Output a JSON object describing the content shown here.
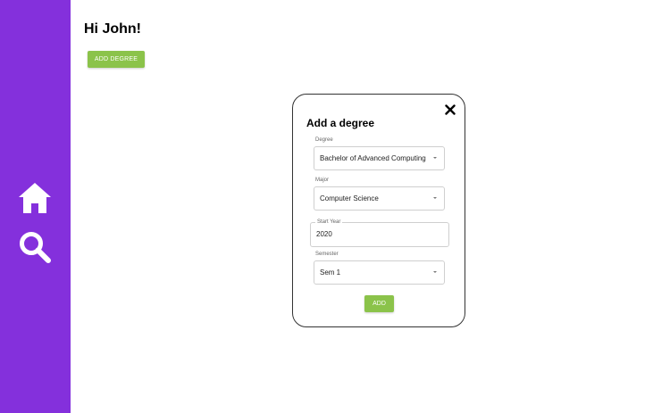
{
  "sidebar": {
    "items": [
      {
        "icon": "home-icon",
        "color": "#ffffff"
      },
      {
        "icon": "search-icon",
        "color": "#ffffff"
      }
    ],
    "background": "#8430dc"
  },
  "main": {
    "greeting": "Hi John!",
    "add_degree_label": "ADD DEGREE"
  },
  "modal": {
    "title": "Add a degree",
    "close_icon": "close-icon",
    "degree": {
      "label": "Degree",
      "value": "Bachelor of Advanced Computing"
    },
    "major": {
      "label": "Major",
      "value": "Computer Science"
    },
    "start_year": {
      "label": "Start Year",
      "value": "2020"
    },
    "semester": {
      "label": "Semester",
      "value": "Sem 1"
    },
    "add_label": "ADD"
  },
  "colors": {
    "accent": "#8bc34a",
    "sidebar": "#8430dc"
  }
}
